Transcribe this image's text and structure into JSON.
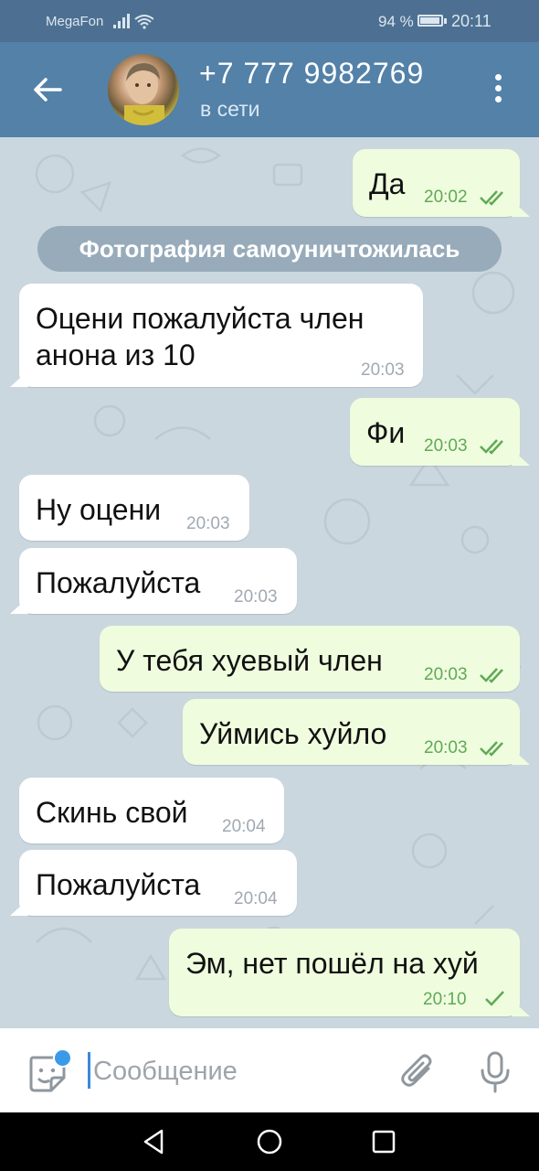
{
  "status_bar": {
    "carrier": "MegaFon",
    "battery": "94 %",
    "time": "20:11"
  },
  "header": {
    "title": "+7 777 9982769",
    "status": "в сети"
  },
  "service_message": "Фотография самоуничтожилась",
  "messages": [
    {
      "dir": "out",
      "text": "Да",
      "time": "20:02",
      "status": "read"
    },
    {
      "dir": "in",
      "text_lines": [
        "Оцени пожалуйста член",
        "анона из 10"
      ],
      "time": "20:03"
    },
    {
      "dir": "out",
      "text": "Фи",
      "time": "20:03",
      "status": "read"
    },
    {
      "dir": "in",
      "text": "Ну оцени",
      "time": "20:03"
    },
    {
      "dir": "in",
      "text": "Пожалуйста",
      "time": "20:03"
    },
    {
      "dir": "out",
      "text": "У тебя хуевый член",
      "time": "20:03",
      "status": "read"
    },
    {
      "dir": "out",
      "text": "Уймись хуйло",
      "time": "20:03",
      "status": "read"
    },
    {
      "dir": "in",
      "text": "Скинь свой",
      "time": "20:04"
    },
    {
      "dir": "in",
      "text": "Пожалуйста",
      "time": "20:04"
    },
    {
      "dir": "out",
      "text": "Эм, нет пошёл на хуй",
      "time": "20:10",
      "status": "sent"
    }
  ],
  "input": {
    "placeholder": "Сообщение"
  },
  "colors": {
    "header": "#5381a8",
    "status_bar": "#4d7092",
    "outgoing_bubble": "#effdde",
    "incoming_bubble": "#ffffff",
    "check": "#5fa956",
    "accent": "#3b9ae8"
  },
  "icons": [
    "back-arrow-icon",
    "more-vert-icon",
    "sticker-icon",
    "attach-icon",
    "mic-icon",
    "nav-back-icon",
    "nav-home-icon",
    "nav-recents-icon",
    "double-check-icon",
    "single-check-icon",
    "signal-icon",
    "wifi-icon",
    "battery-icon"
  ]
}
